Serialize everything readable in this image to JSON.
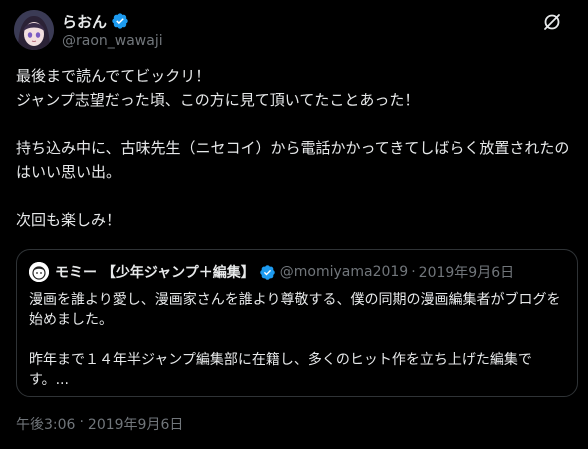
{
  "tweet": {
    "display_name": "らおん",
    "handle": "@raon_wawaji",
    "avatar_icon": "user-avatar",
    "verified_icon": "verified-badge-icon",
    "menu_icon": "grok-icon",
    "paragraphs": [
      "最後まで読んでてビックリ！\nジャンプ志望だった頃、この方に見て頂いてたことあった！",
      "持ち込み中に、古味先生（ニセコイ）から電話かかってきてしばらく放置されたのはいい思い出。",
      "次回も楽しみ！"
    ],
    "time": "午後3:06",
    "date": "2019年9月6日"
  },
  "quote": {
    "display_name": "モミー 【少年ジャンプ＋編集】",
    "handle": "@momiyama2019",
    "date": "2019年9月6日",
    "avatar_icon": "user-avatar",
    "verified_icon": "verified-badge-icon",
    "paragraphs": [
      "漫画を誰より愛し、漫画家さんを誰より尊敬する、僕の同期の漫画編集者がブログを始めました。",
      "昨年まで１４年半ジャンプ編集部に在籍し、多くのヒット作を立ち上げた編集です。..."
    ]
  },
  "colors": {
    "background": "#000000",
    "text": "#e7e9ea",
    "muted": "#71767b",
    "border": "#2f3336",
    "verified": "#1d9bf0"
  }
}
